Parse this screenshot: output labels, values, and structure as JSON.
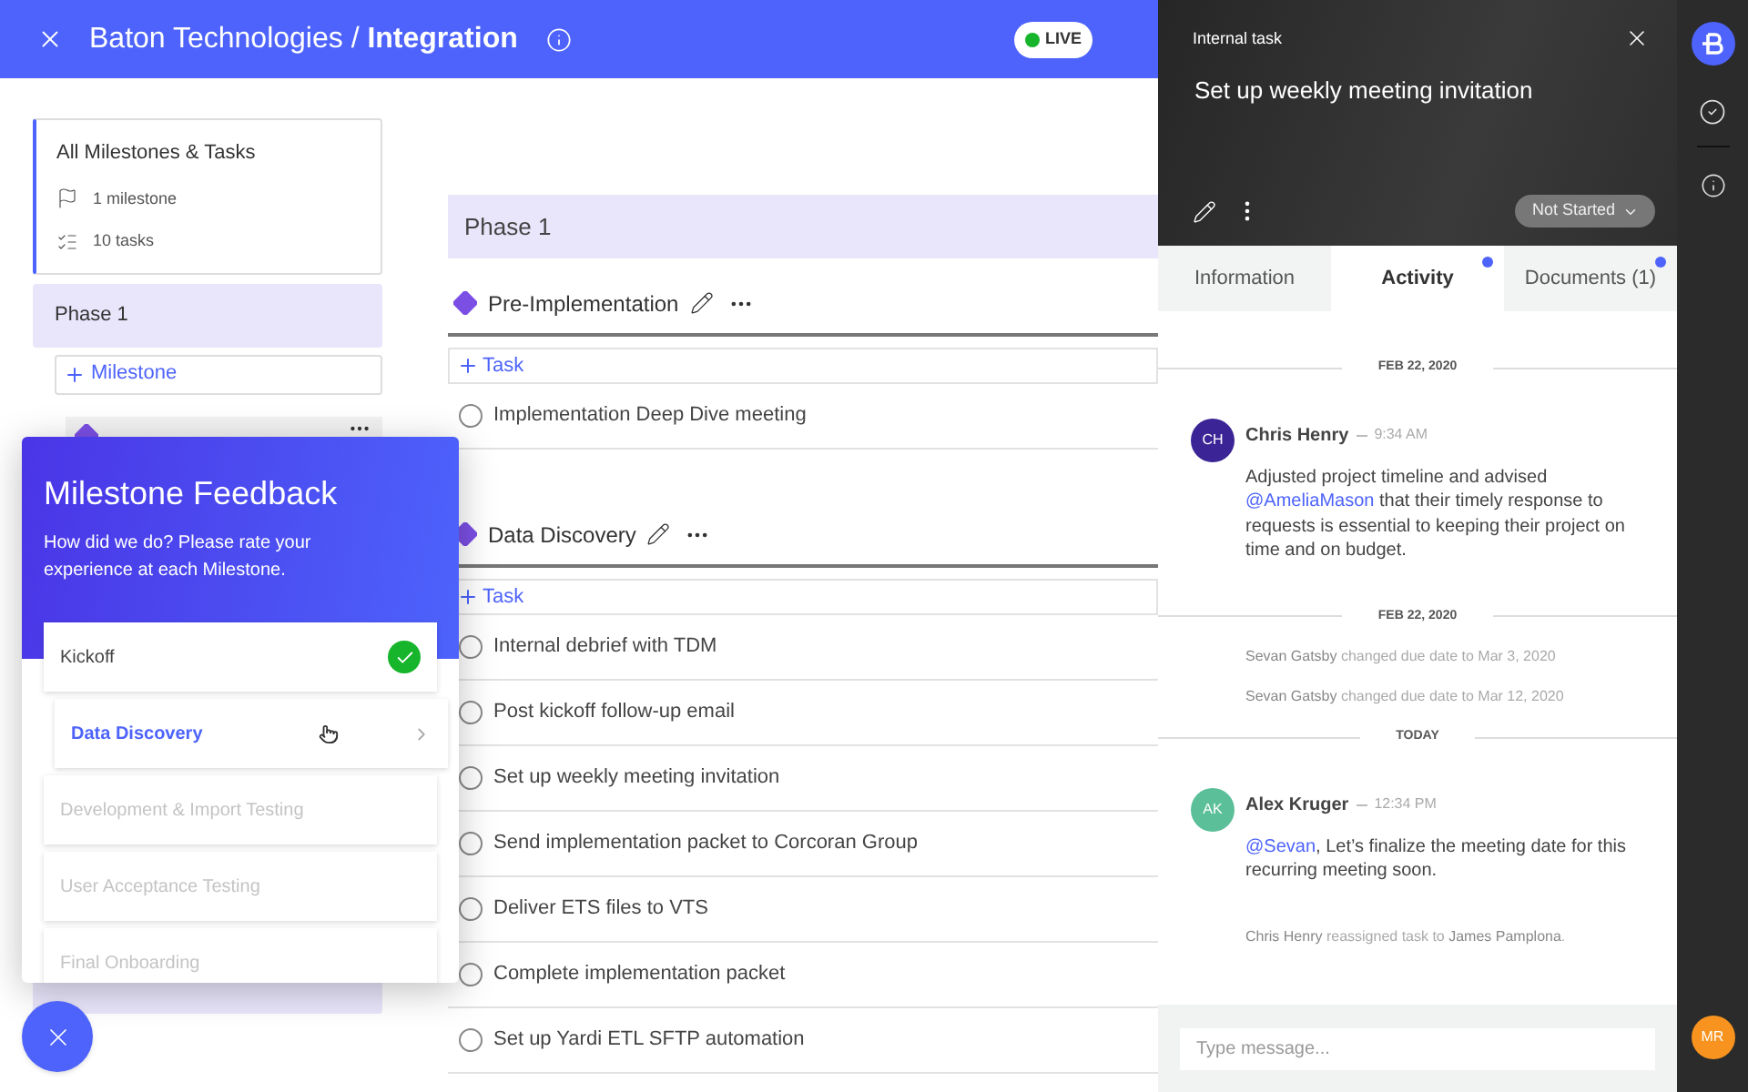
{
  "header": {
    "title": "Baton Technologies / **Integration**",
    "status_badge": "LIVE"
  },
  "sidebar": {
    "summary": {
      "title": "All Milestones & Tasks",
      "milestones": "1 milestone",
      "tasks": "10 tasks",
      "selected": true
    },
    "phase": {
      "label": "Phase 1",
      "selected": true
    },
    "add_milestone": "Milestone"
  },
  "main": {
    "phase": "Phase 1",
    "milestones": [
      {
        "name": "Pre-Implementation",
        "add_task": "Task",
        "tasks": [
          {
            "label": "Implementation Deep Dive meeting",
            "checked": false
          }
        ]
      },
      {
        "name": "Data Discovery",
        "add_task": "Task",
        "tasks": [
          {
            "label": "Internal debrief with TDM",
            "checked": false
          },
          {
            "label": "Post kickoff follow-up email",
            "checked": false
          },
          {
            "label": "Set up weekly meeting invitation",
            "checked": false
          },
          {
            "label": "Send implementation packet to Corcoran Group",
            "checked": false
          },
          {
            "label": "Deliver ETS files to VTS",
            "checked": false
          },
          {
            "label": "Complete implementation packet",
            "checked": false
          },
          {
            "label": "Set up Yardi ETL SFTP automation",
            "checked": false
          }
        ]
      }
    ]
  },
  "feedback": {
    "title": "Milestone Feedback",
    "subtitle": "How did we do? Please rate your experience at each Milestone.",
    "items": [
      {
        "label": "Kickoff",
        "checked": true,
        "selected": false,
        "disabled": false
      },
      {
        "label": "Data Discovery",
        "checked": false,
        "selected": true,
        "disabled": false
      },
      {
        "label": "Development & Import Testing",
        "checked": false,
        "selected": false,
        "disabled": true
      },
      {
        "label": "User Acceptance Testing",
        "checked": false,
        "selected": false,
        "disabled": true
      },
      {
        "label": "Final Onboarding",
        "checked": false,
        "selected": false,
        "disabled": true
      }
    ]
  },
  "task_panel": {
    "kind": "Internal task",
    "title": "Set up weekly meeting invitation",
    "status": "Not Started",
    "tabs": [
      {
        "label": "Information",
        "selected": false,
        "badge_dot": false
      },
      {
        "label": "Activity",
        "selected": true,
        "badge_dot": true
      },
      {
        "label": "Documents (1)",
        "selected": false,
        "badge_dot": true
      }
    ],
    "feed": [
      {
        "kind": "date",
        "label": "FEB 22, 2020"
      },
      {
        "kind": "comment",
        "initials": "CH",
        "color": "#3b2596",
        "author": "Chris Henry",
        "time": "9:34 AM",
        "body": [
          {
            "text": "Adjusted project timeline and advised ",
            "mention": false
          },
          {
            "text": "@AmeliaMason",
            "mention": true
          },
          {
            "text": " that their timely response to requests is essential to keeping their project on time and on budget.",
            "mention": false
          }
        ]
      },
      {
        "kind": "date",
        "label": "FEB 22, 2020"
      },
      {
        "kind": "event",
        "text": "**Sevan Gatsby** changed due date to Mar 3, 2020"
      },
      {
        "kind": "event",
        "text": "**Sevan Gatsby** changed due date to Mar 12, 2020"
      },
      {
        "kind": "date",
        "label": "TODAY"
      },
      {
        "kind": "comment",
        "initials": "AK",
        "color": "#5bbf9a",
        "author": "Alex Kruger",
        "time": "12:34 PM",
        "body": [
          {
            "text": "@Sevan",
            "mention": true
          },
          {
            "text": ", Let’s finalize the meeting date for this recurring meeting soon.",
            "mention": false
          }
        ]
      },
      {
        "kind": "event",
        "text": "**Chris Henry** reassigned task to **James Pamplona**."
      }
    ],
    "message": {
      "placeholder": "Type message..."
    }
  },
  "rail": {
    "user_initials": "MR"
  }
}
